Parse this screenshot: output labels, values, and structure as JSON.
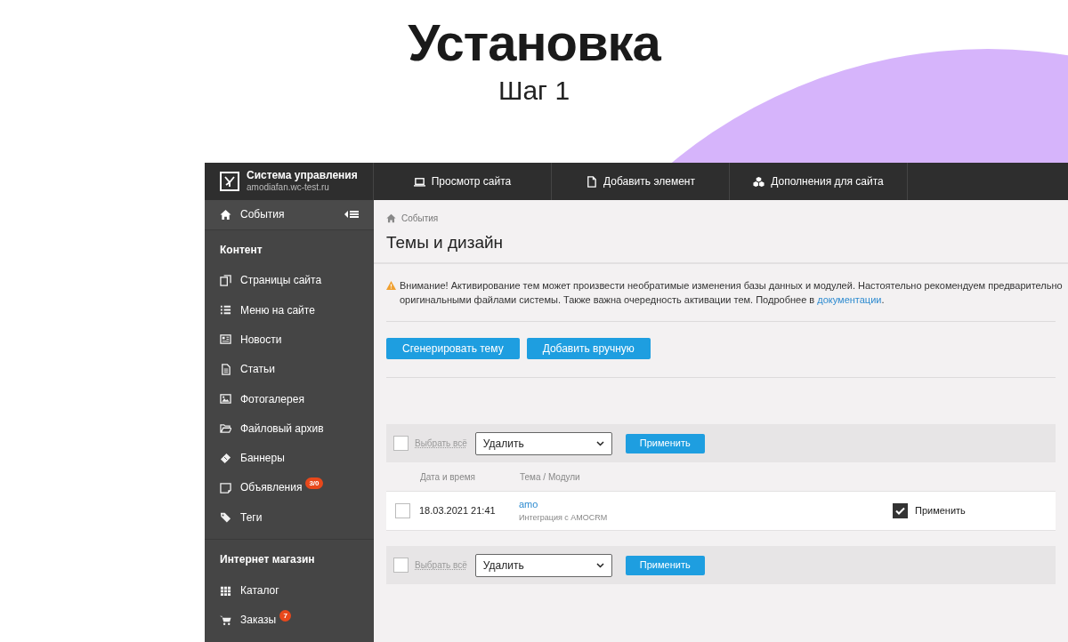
{
  "slide": {
    "title": "Установка",
    "subtitle": "Шаг 1"
  },
  "app": {
    "brand": {
      "name": "Система управления",
      "domain": "amodiafan.wc-test.ru"
    },
    "top_nav": [
      {
        "label": "Просмотр сайта",
        "kind": "laptop"
      },
      {
        "label": "Добавить элемент",
        "kind": "file"
      },
      {
        "label": "Дополнения для сайта",
        "kind": "cubes"
      }
    ],
    "sidebar": {
      "current": "События",
      "sections": [
        {
          "title": "Контент",
          "items": [
            {
              "label": "Страницы сайта",
              "kind": "pages"
            },
            {
              "label": "Меню на сайте",
              "kind": "list"
            },
            {
              "label": "Новости",
              "kind": "news"
            },
            {
              "label": "Статьи",
              "kind": "doc"
            },
            {
              "label": "Фотогалерея",
              "kind": "image"
            },
            {
              "label": "Файловый архив",
              "kind": "folder"
            },
            {
              "label": "Баннеры",
              "kind": "ticket"
            },
            {
              "label": "Объявления",
              "kind": "note",
              "badge": "3/0"
            },
            {
              "label": "Теги",
              "kind": "tags"
            }
          ]
        },
        {
          "title": "Интернет магазин",
          "items": [
            {
              "label": "Каталог",
              "kind": "grid"
            },
            {
              "label": "Заказы",
              "kind": "cart",
              "badge": "7"
            }
          ]
        }
      ]
    },
    "content": {
      "breadcrumb": "События",
      "title": "Темы и дизайн",
      "warning": {
        "line1": "Внимание! Активирование тем может произвести необратимые изменения базы данных и модулей. Настоятельно рекомендуем предварительно",
        "line2": "оригинальными файлами системы. Также важна очередность активации тем. Подробнее в ",
        "link": "документации",
        "end": "."
      },
      "buttons": [
        "Сгенерировать тему",
        "Добавить вручную"
      ],
      "bulk_bars": [
        {
          "checked": false,
          "select_all": "Выбрать всё",
          "action": "Удалить",
          "apply": "Применить"
        },
        {
          "checked": false,
          "select_all": "Выбрать всё",
          "action": "Удалить",
          "apply": "Применить"
        }
      ],
      "table": {
        "columns": [
          "Дата и время",
          "Тема / Модули"
        ],
        "rows": [
          {
            "checked": false,
            "date": "18.03.2021 21:41",
            "theme": "amo",
            "modules": "Интеграция с AMOCRM",
            "apply": {
              "label": "Применить",
              "checked": true
            }
          }
        ]
      }
    }
  }
}
